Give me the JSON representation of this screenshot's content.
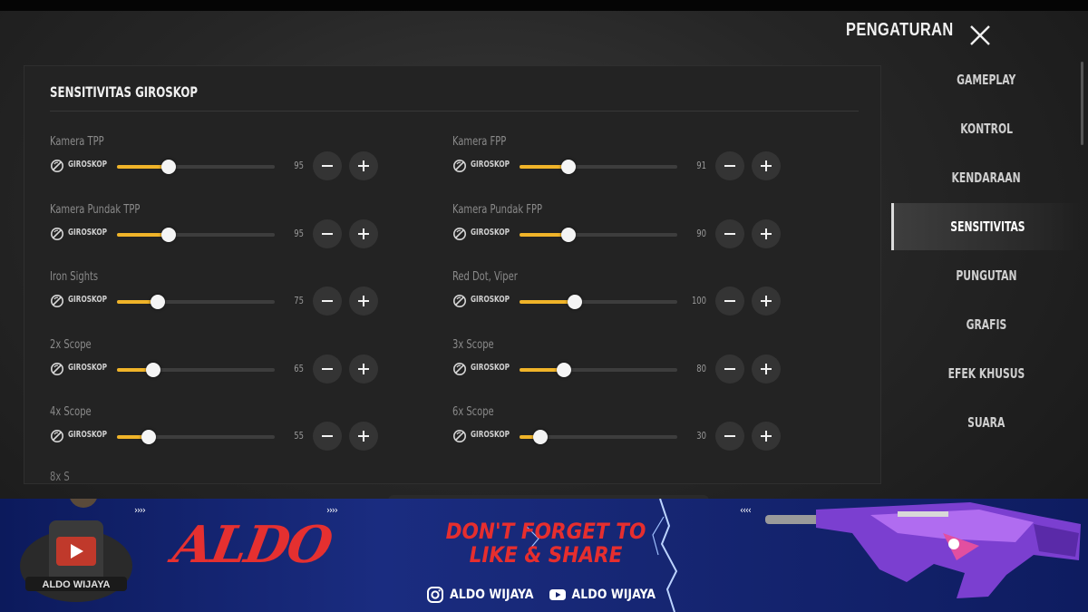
{
  "header": {
    "title": "PENGATURAN"
  },
  "panel": {
    "title": "SENSITIVITAS GIROSKOP",
    "cut_label": "8x S"
  },
  "gyro_label": "GIROSKOP",
  "settings": [
    {
      "label": "Kamera TPP",
      "value": "95",
      "level": 0.33
    },
    {
      "label": "Kamera FPP",
      "value": "91",
      "level": 0.31
    },
    {
      "label": "Kamera Pundak TPP",
      "value": "95",
      "level": 0.33
    },
    {
      "label": "Kamera Pundak FPP",
      "value": "90",
      "level": 0.31
    },
    {
      "label": "Iron Sights",
      "value": "75",
      "level": 0.26
    },
    {
      "label": "Red Dot, Viper",
      "value": "100",
      "level": 0.35
    },
    {
      "label": "2x Scope",
      "value": "65",
      "level": 0.23
    },
    {
      "label": "3x Scope",
      "value": "80",
      "level": 0.28
    },
    {
      "label": "4x Scope",
      "value": "55",
      "level": 0.2
    },
    {
      "label": "6x Scope",
      "value": "30",
      "level": 0.13
    }
  ],
  "sidebar": {
    "items": [
      {
        "label": "GAMEPLAY"
      },
      {
        "label": "KONTROL"
      },
      {
        "label": "KENDARAAN"
      },
      {
        "label": "SENSITIVITAS",
        "active": true
      },
      {
        "label": "PUNGUTAN"
      },
      {
        "label": "GRAFIS"
      },
      {
        "label": "EFEK KHUSUS"
      },
      {
        "label": "SUARA"
      }
    ]
  },
  "banner": {
    "arrows_right": "››››",
    "arrows_left": "‹‹‹‹",
    "name": "ALDO",
    "cta_line1": "DON'T FORGET TO",
    "cta_line2": "LIKE & SHARE",
    "instagram": "ALDO WIJAYA",
    "youtube": "ALDO WIJAYA",
    "avatar_text": "ALDO WIJAYA"
  },
  "colors": {
    "accent": "#f0b429",
    "banner_bg": "#14236b",
    "banner_red": "#e53030"
  }
}
